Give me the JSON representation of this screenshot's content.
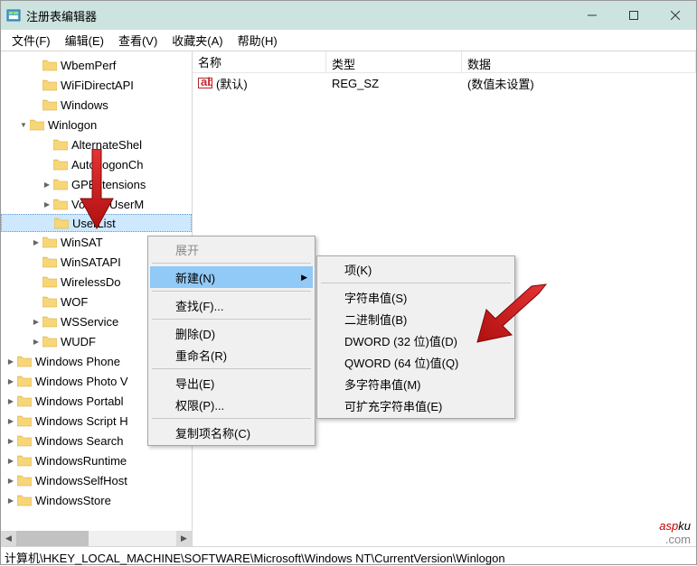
{
  "window": {
    "title": "注册表编辑器"
  },
  "menubar": [
    "文件(F)",
    "编辑(E)",
    "查看(V)",
    "收藏夹(A)",
    "帮助(H)"
  ],
  "tree": {
    "items_top": [
      {
        "label": "WbemPerf",
        "indent": "ind1",
        "exp": ""
      },
      {
        "label": "WiFiDirectAPI",
        "indent": "ind1",
        "exp": ""
      },
      {
        "label": "Windows",
        "indent": "ind1",
        "exp": ""
      }
    ],
    "winlogon": {
      "label": "Winlogon",
      "indent": "ind2",
      "exp": "expanded"
    },
    "winlogon_children": [
      {
        "label": "AlternateShel",
        "indent": "ind3",
        "exp": ""
      },
      {
        "label": "AutoLogonCh",
        "indent": "ind3",
        "exp": ""
      },
      {
        "label": "GPExtensions",
        "indent": "ind3",
        "exp": "collapsed"
      },
      {
        "label": "VolatileUserM",
        "indent": "ind3",
        "exp": "collapsed"
      }
    ],
    "userlist": {
      "label": "UserList",
      "indent": "ind3",
      "exp": ""
    },
    "items_mid": [
      {
        "label": "WinSAT",
        "indent": "ind1",
        "exp": "collapsed"
      },
      {
        "label": "WinSATAPI",
        "indent": "ind1",
        "exp": ""
      },
      {
        "label": "WirelessDo",
        "indent": "ind1",
        "exp": ""
      },
      {
        "label": "WOF",
        "indent": "ind1",
        "exp": ""
      },
      {
        "label": "WSService",
        "indent": "ind1",
        "exp": "collapsed"
      },
      {
        "label": "WUDF",
        "indent": "ind1",
        "exp": "collapsed"
      }
    ],
    "items_bottom": [
      {
        "label": "Windows Phone",
        "indent": "ind0",
        "exp": "collapsed"
      },
      {
        "label": "Windows Photo V",
        "indent": "ind0",
        "exp": "collapsed"
      },
      {
        "label": "Windows Portabl",
        "indent": "ind0",
        "exp": "collapsed"
      },
      {
        "label": "Windows Script H",
        "indent": "ind0",
        "exp": "collapsed"
      },
      {
        "label": "Windows Search",
        "indent": "ind0",
        "exp": "collapsed"
      },
      {
        "label": "WindowsRuntime",
        "indent": "ind0",
        "exp": "collapsed"
      },
      {
        "label": "WindowsSelfHost",
        "indent": "ind0",
        "exp": "collapsed"
      },
      {
        "label": "WindowsStore",
        "indent": "ind0",
        "exp": "collapsed"
      }
    ]
  },
  "list": {
    "columns": {
      "name": "名称",
      "type": "类型",
      "data": "数据"
    },
    "rows": [
      {
        "name": "(默认)",
        "type": "REG_SZ",
        "data": "(数值未设置)"
      }
    ]
  },
  "context1": {
    "expand": "展开",
    "new": "新建(N)",
    "find": "查找(F)...",
    "delete": "删除(D)",
    "rename": "重命名(R)",
    "export": "导出(E)",
    "permissions": "权限(P)...",
    "copykey": "复制项名称(C)"
  },
  "context2": {
    "key": "项(K)",
    "string": "字符串值(S)",
    "binary": "二进制值(B)",
    "dword": "DWORD (32 位)值(D)",
    "qword": "QWORD (64 位)值(Q)",
    "multistring": "多字符串值(M)",
    "expandable": "可扩充字符串值(E)"
  },
  "statusbar": "计算机\\HKEY_LOCAL_MACHINE\\SOFTWARE\\Microsoft\\Windows NT\\CurrentVersion\\Winlogon",
  "watermark": {
    "part1": "asp",
    "part2": "ku",
    "sub": ".com"
  }
}
